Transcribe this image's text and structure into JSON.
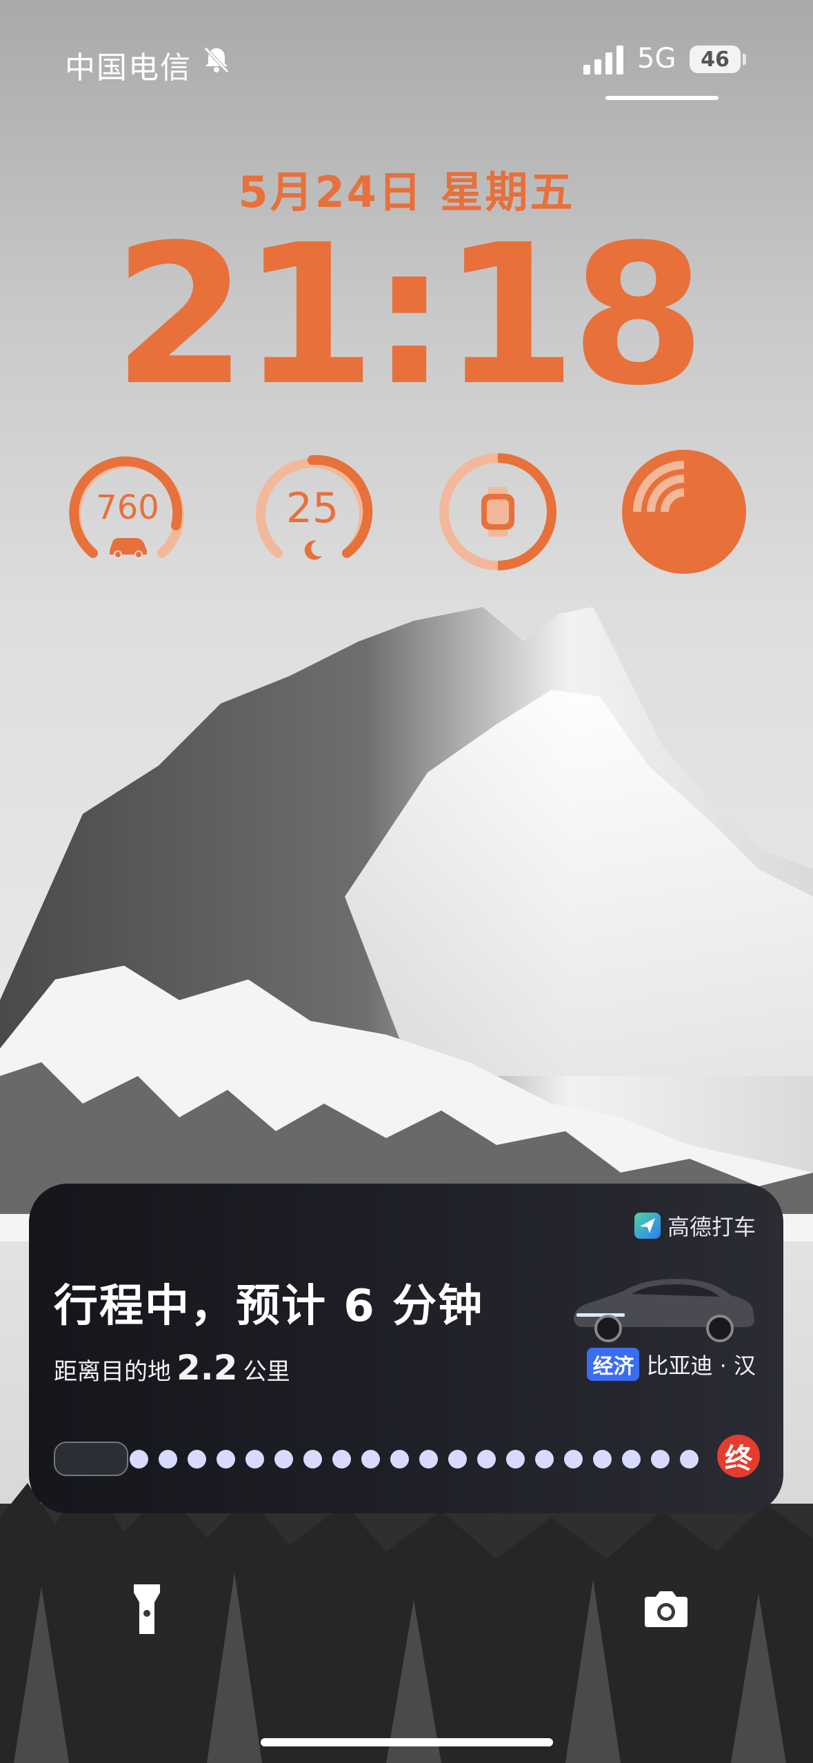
{
  "status_bar": {
    "carrier": "中国电信",
    "network": "5G",
    "battery": "46"
  },
  "lock": {
    "date": "5月24日 星期五",
    "time": "21:18"
  },
  "widgets": [
    {
      "value": "760",
      "icon": "car-icon",
      "ring_fraction": 0.7
    },
    {
      "value": "25",
      "icon": "moon-icon",
      "ring_fraction": 0.72
    },
    {
      "icon": "watch-icon",
      "ring_fraction": 0.5
    },
    {
      "icon": "activity-rings-icon"
    }
  ],
  "live_activity": {
    "brand": "高德打车",
    "title": "行程中，预计 6 分钟",
    "subtitle_prefix": "距离目的地",
    "distance": "2.2",
    "unit": "公里",
    "badge": "经济",
    "car_model": "比亚迪 · 汉",
    "end_label": "终",
    "progress_dots": 20
  },
  "buttons": {
    "flashlight": "flashlight-icon",
    "camera": "camera-icon"
  },
  "colors": {
    "accent": "#e8703a",
    "card_bg": "#1c1d24",
    "badge": "#3a6df0",
    "end": "#e53c2e"
  }
}
